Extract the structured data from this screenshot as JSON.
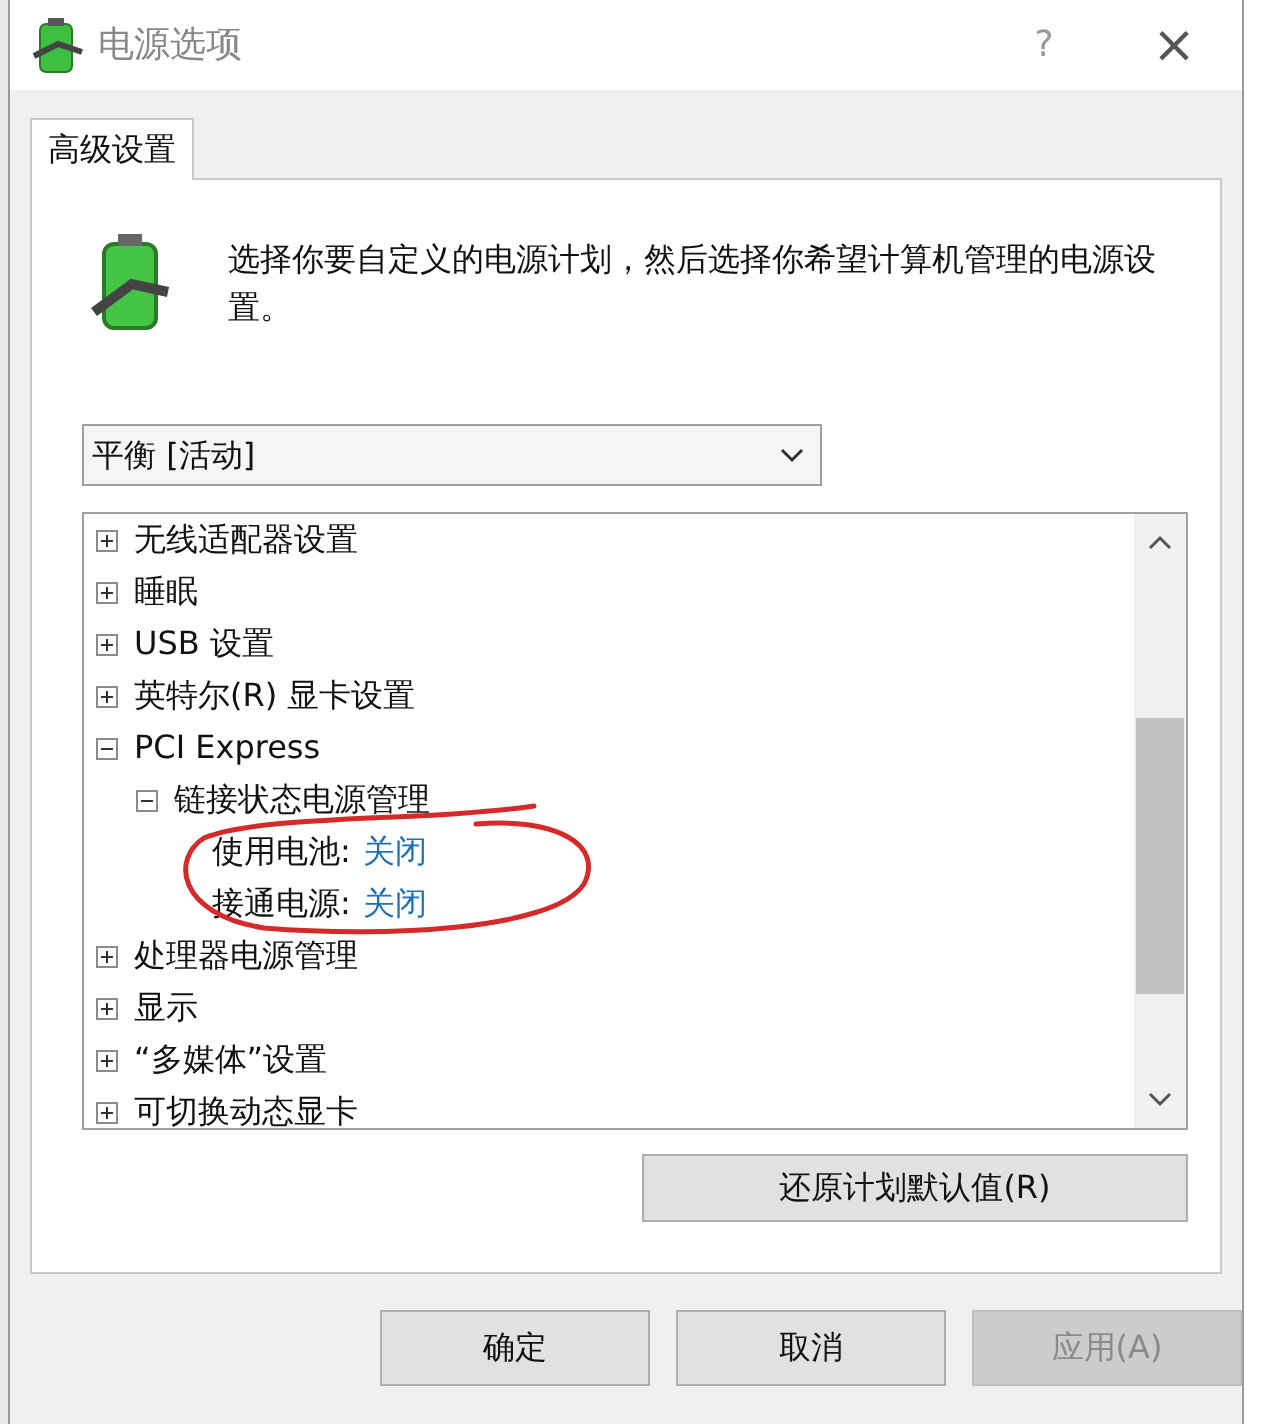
{
  "window": {
    "title": "电源选项",
    "help": "?",
    "close": "×"
  },
  "tabs": [
    {
      "label": "高级设置",
      "selected": true
    }
  ],
  "intro": "选择你要自定义的电源计划，然后选择你希望计算机管理的电源设置。",
  "plan_dropdown": {
    "value": "平衡 [活动]"
  },
  "tree": [
    {
      "label": "无线适配器设置",
      "expanded": false
    },
    {
      "label": "睡眠",
      "expanded": false
    },
    {
      "label": "USB 设置",
      "expanded": false
    },
    {
      "label": "英特尔(R) 显卡设置",
      "expanded": false
    },
    {
      "label": "PCI Express",
      "expanded": true,
      "children": [
        {
          "label": "链接状态电源管理",
          "expanded": true,
          "children": [
            {
              "label": "使用电池:",
              "value": "关闭"
            },
            {
              "label": "接通电源:",
              "value": "关闭"
            }
          ]
        }
      ]
    },
    {
      "label": "处理器电源管理",
      "expanded": false
    },
    {
      "label": "显示",
      "expanded": false
    },
    {
      "label": "“多媒体”设置",
      "expanded": false
    },
    {
      "label": "可切换动态显卡",
      "expanded": false
    }
  ],
  "restore_button": "还原计划默认值(R)",
  "buttons": [
    {
      "label": "确定",
      "disabled": false
    },
    {
      "label": "取消",
      "disabled": false
    },
    {
      "label": "应用(A)",
      "disabled": true
    }
  ]
}
